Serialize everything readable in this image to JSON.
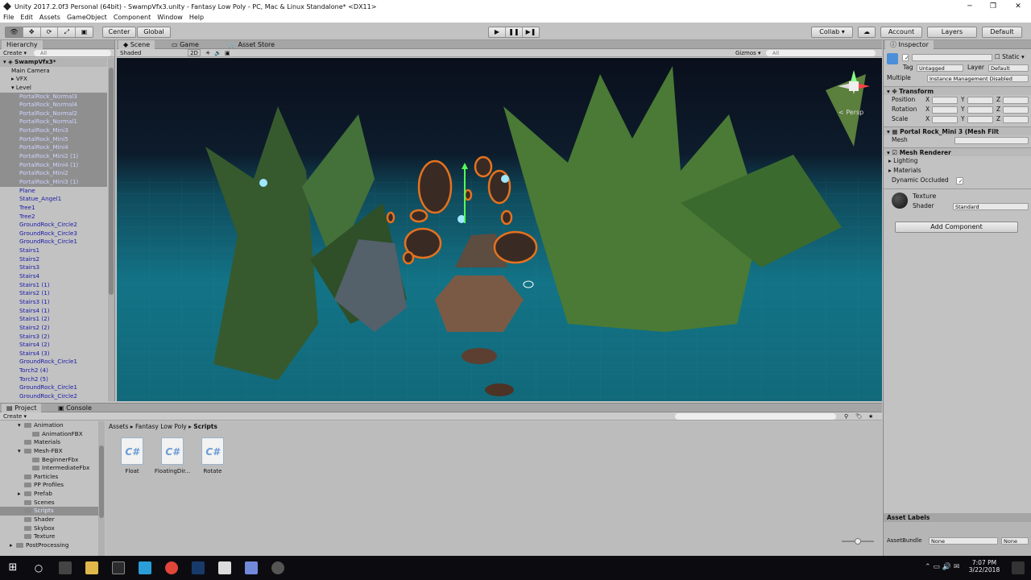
{
  "window": {
    "title": "Unity 2017.2.0f3 Personal (64bit) - SwampVfx3.unity - Fantasy Low Poly - PC, Mac & Linux Standalone* <DX11>",
    "min": "─",
    "max": "❐",
    "close": "✕"
  },
  "menu": [
    "File",
    "Edit",
    "Assets",
    "GameObject",
    "Component",
    "Window",
    "Help"
  ],
  "toolbar": {
    "center": "Center",
    "global": "Global",
    "collab": "Collab ▾",
    "account": "Account",
    "layers": "Layers",
    "layout": "Default"
  },
  "hierarchy": {
    "tab": "Hierarchy",
    "create": "Create ▾",
    "search": "All",
    "scene": "SwampVfx3*",
    "items": [
      {
        "label": "Main Camera",
        "indent": 1,
        "style": "black"
      },
      {
        "label": "VFX",
        "indent": 1,
        "style": "black",
        "arrow": "▸"
      },
      {
        "label": "Level",
        "indent": 1,
        "style": "black",
        "arrow": "▾"
      },
      {
        "label": "PortalRock_Normal3",
        "indent": 2,
        "style": "sel"
      },
      {
        "label": "PortalRock_Normal4",
        "indent": 2,
        "style": "sel"
      },
      {
        "label": "PortalRock_Normal2",
        "indent": 2,
        "style": "sel"
      },
      {
        "label": "PortalRock_Normal1",
        "indent": 2,
        "style": "sel"
      },
      {
        "label": "PortalRock_Mini3",
        "indent": 2,
        "style": "sel"
      },
      {
        "label": "PortalRock_Mini5",
        "indent": 2,
        "style": "sel"
      },
      {
        "label": "PortalRock_Mini4",
        "indent": 2,
        "style": "sel"
      },
      {
        "label": "PortalRock_Mini2 (1)",
        "indent": 2,
        "style": "sel"
      },
      {
        "label": "PortalRock_Mini4 (1)",
        "indent": 2,
        "style": "sel"
      },
      {
        "label": "PortalRock_Mini2",
        "indent": 2,
        "style": "sel"
      },
      {
        "label": "PortalRock_Mini3 (1)",
        "indent": 2,
        "style": "sel"
      },
      {
        "label": "Plane",
        "indent": 2,
        "style": ""
      },
      {
        "label": "Statue_Angel1",
        "indent": 2,
        "style": ""
      },
      {
        "label": "Tree1",
        "indent": 2,
        "style": ""
      },
      {
        "label": "Tree2",
        "indent": 2,
        "style": ""
      },
      {
        "label": "GroundRock_Circle2",
        "indent": 2,
        "style": ""
      },
      {
        "label": "GroundRock_Circle3",
        "indent": 2,
        "style": ""
      },
      {
        "label": "GroundRock_Circle1",
        "indent": 2,
        "style": ""
      },
      {
        "label": "Stairs1",
        "indent": 2,
        "style": ""
      },
      {
        "label": "Stairs2",
        "indent": 2,
        "style": ""
      },
      {
        "label": "Stairs3",
        "indent": 2,
        "style": ""
      },
      {
        "label": "Stairs4",
        "indent": 2,
        "style": ""
      },
      {
        "label": "Stairs1 (1)",
        "indent": 2,
        "style": ""
      },
      {
        "label": "Stairs2 (1)",
        "indent": 2,
        "style": ""
      },
      {
        "label": "Stairs3 (1)",
        "indent": 2,
        "style": ""
      },
      {
        "label": "Stairs4 (1)",
        "indent": 2,
        "style": ""
      },
      {
        "label": "Stairs1 (2)",
        "indent": 2,
        "style": ""
      },
      {
        "label": "Stairs2 (2)",
        "indent": 2,
        "style": ""
      },
      {
        "label": "Stairs3 (2)",
        "indent": 2,
        "style": ""
      },
      {
        "label": "Stairs4 (2)",
        "indent": 2,
        "style": ""
      },
      {
        "label": "Stairs4 (3)",
        "indent": 2,
        "style": ""
      },
      {
        "label": "GroundRock_Circle1",
        "indent": 2,
        "style": ""
      },
      {
        "label": "Torch2 (4)",
        "indent": 2,
        "style": ""
      },
      {
        "label": "Torch2 (5)",
        "indent": 2,
        "style": ""
      },
      {
        "label": "GroundRock_Circle1",
        "indent": 2,
        "style": ""
      },
      {
        "label": "GroundRock_Circle2",
        "indent": 2,
        "style": ""
      }
    ]
  },
  "scene": {
    "tab_scene": "Scene",
    "tab_game": "Game",
    "tab_store": "Asset Store",
    "shading": "Shaded",
    "mode2d": "2D",
    "gizmos": "Gizmos ▾",
    "search": "All",
    "persp": "< Persp"
  },
  "inspector": {
    "tab": "Inspector",
    "static": "Static",
    "tag_label": "Tag",
    "tag": "Untagged",
    "layer_label": "Layer",
    "layer": "Default",
    "multiple": "Multiple",
    "instance": "Instance Management Disabled",
    "transform": "Transform",
    "position": "Position",
    "rotation": "Rotation",
    "scale": "Scale",
    "x": "X",
    "y": "Y",
    "z": "Z",
    "meshfilter": "Portal Rock_Mini 3 (Mesh Filt",
    "mesh": "Mesh",
    "meshrenderer": "Mesh Renderer",
    "lighting": "Lighting",
    "materials": "Materials",
    "dynamic": "Dynamic Occluded",
    "texture": "Texture",
    "shader_label": "Shader",
    "shader": "Standard",
    "add_component": "Add Component",
    "asset_labels": "Asset Labels",
    "assetbundle": "AssetBundle",
    "none": "None"
  },
  "project": {
    "tab_project": "Project",
    "tab_console": "Console",
    "create": "Create ▾",
    "breadcrumb": [
      "Assets",
      "Fantasy Low Poly",
      "Scripts"
    ],
    "tree": [
      {
        "label": "Animation",
        "indent": 2,
        "arrow": "▾"
      },
      {
        "label": "AnimationFBX",
        "indent": 3,
        "arrow": ""
      },
      {
        "label": "Materials",
        "indent": 2,
        "arrow": ""
      },
      {
        "label": "Mesh-FBX",
        "indent": 2,
        "arrow": "▾"
      },
      {
        "label": "BeginnerFbx",
        "indent": 3,
        "arrow": ""
      },
      {
        "label": "IntermediateFbx",
        "indent": 3,
        "arrow": ""
      },
      {
        "label": "Particles",
        "indent": 2,
        "arrow": ""
      },
      {
        "label": "PP Profiles",
        "indent": 2,
        "arrow": ""
      },
      {
        "label": "Prefab",
        "indent": 2,
        "arrow": "▸"
      },
      {
        "label": "Scenes",
        "indent": 2,
        "arrow": ""
      },
      {
        "label": "Scripts",
        "indent": 2,
        "arrow": "",
        "sel": true
      },
      {
        "label": "Shader",
        "indent": 2,
        "arrow": ""
      },
      {
        "label": "Skybox",
        "indent": 2,
        "arrow": ""
      },
      {
        "label": "Texture",
        "indent": 2,
        "arrow": ""
      },
      {
        "label": "PostProcessing",
        "indent": 1,
        "arrow": "▸"
      }
    ],
    "assets": [
      "Float",
      "FloatingDir...",
      "Rotate"
    ],
    "cs": "C#"
  },
  "taskbar": {
    "time": "7:07 PM",
    "date": "3/22/2018"
  },
  "colors": {
    "selection": "#8f8f8f",
    "prefab_text": "#1a1aa8",
    "panel": "#c2c2c2"
  }
}
